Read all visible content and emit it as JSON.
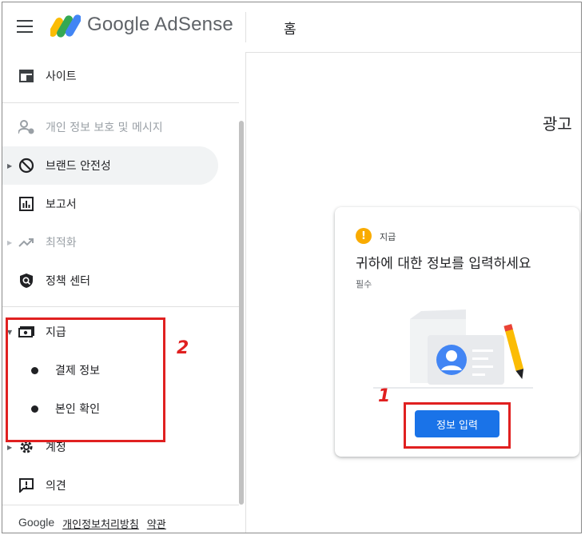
{
  "header": {
    "brand": "Google AdSense",
    "page_title": "홈"
  },
  "sidebar": {
    "items": [
      {
        "label": "사이트",
        "icon": "site-icon"
      },
      {
        "label": "개인 정보 보호 및 메시지",
        "icon": "privacy-icon",
        "disabled": true
      },
      {
        "label": "브랜드 안전성",
        "icon": "block-icon",
        "expandable": true,
        "active": true
      },
      {
        "label": "보고서",
        "icon": "report-icon"
      },
      {
        "label": "최적화",
        "icon": "trending-icon",
        "disabled": true,
        "expandable": true
      },
      {
        "label": "정책 센터",
        "icon": "policy-shield-icon"
      },
      {
        "label": "지급",
        "icon": "payments-icon",
        "expanded": true
      },
      {
        "label": "계정",
        "icon": "gear-icon",
        "expandable": true
      },
      {
        "label": "의견",
        "icon": "feedback-icon"
      }
    ],
    "payments_sub": [
      {
        "label": "결제 정보"
      },
      {
        "label": "본인 확인"
      }
    ]
  },
  "footer": {
    "brand": "Google",
    "privacy": "개인정보처리방침",
    "terms": "약관"
  },
  "main": {
    "heading": "광고",
    "card": {
      "label": "지급",
      "title": "귀하에 대한 정보를 입력하세요",
      "subtitle": "필수",
      "button": "정보 입력"
    }
  },
  "annotations": {
    "one": "1",
    "two": "2"
  },
  "colors": {
    "accent": "#1a73e8",
    "warning": "#f9ab00",
    "highlight": "#e02020"
  }
}
